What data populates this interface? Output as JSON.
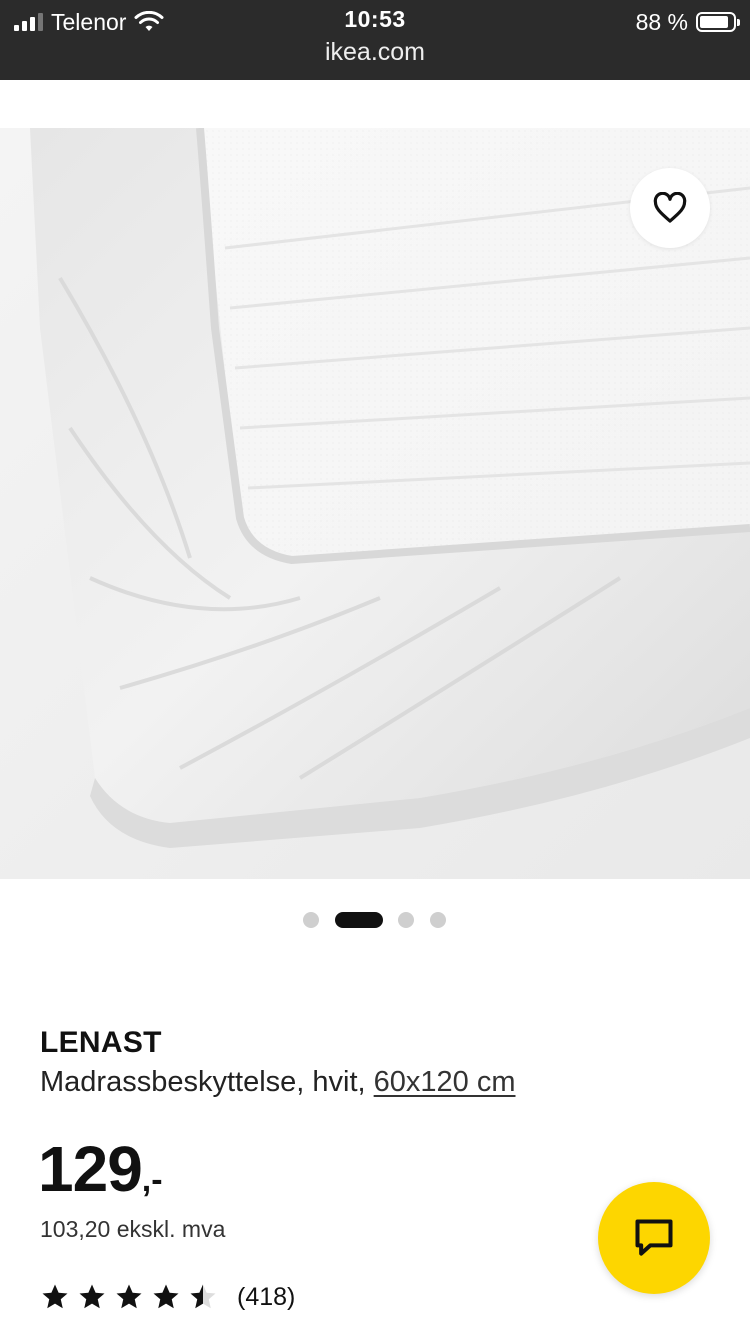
{
  "status_bar": {
    "carrier": "Telenor",
    "time": "10:53",
    "url": "ikea.com",
    "battery": "88 %",
    "battery_level": 0.88
  },
  "gallery": {
    "image_alt": "Madrassbeskyttelse, hvit",
    "favorite_icon": "heart-icon",
    "dot_count": 4,
    "active_index": 1
  },
  "product": {
    "brand": "LENAST",
    "description": "Madrassbeskyttelse, hvit, ",
    "size": "60x120 cm",
    "price": "129",
    "price_suffix": ",-",
    "price_ex_vat": "103,20 ekskl. mva",
    "rating": 4.5,
    "review_count": "(418)"
  },
  "chat": {
    "icon": "chat-icon",
    "color": "#fdd600"
  }
}
